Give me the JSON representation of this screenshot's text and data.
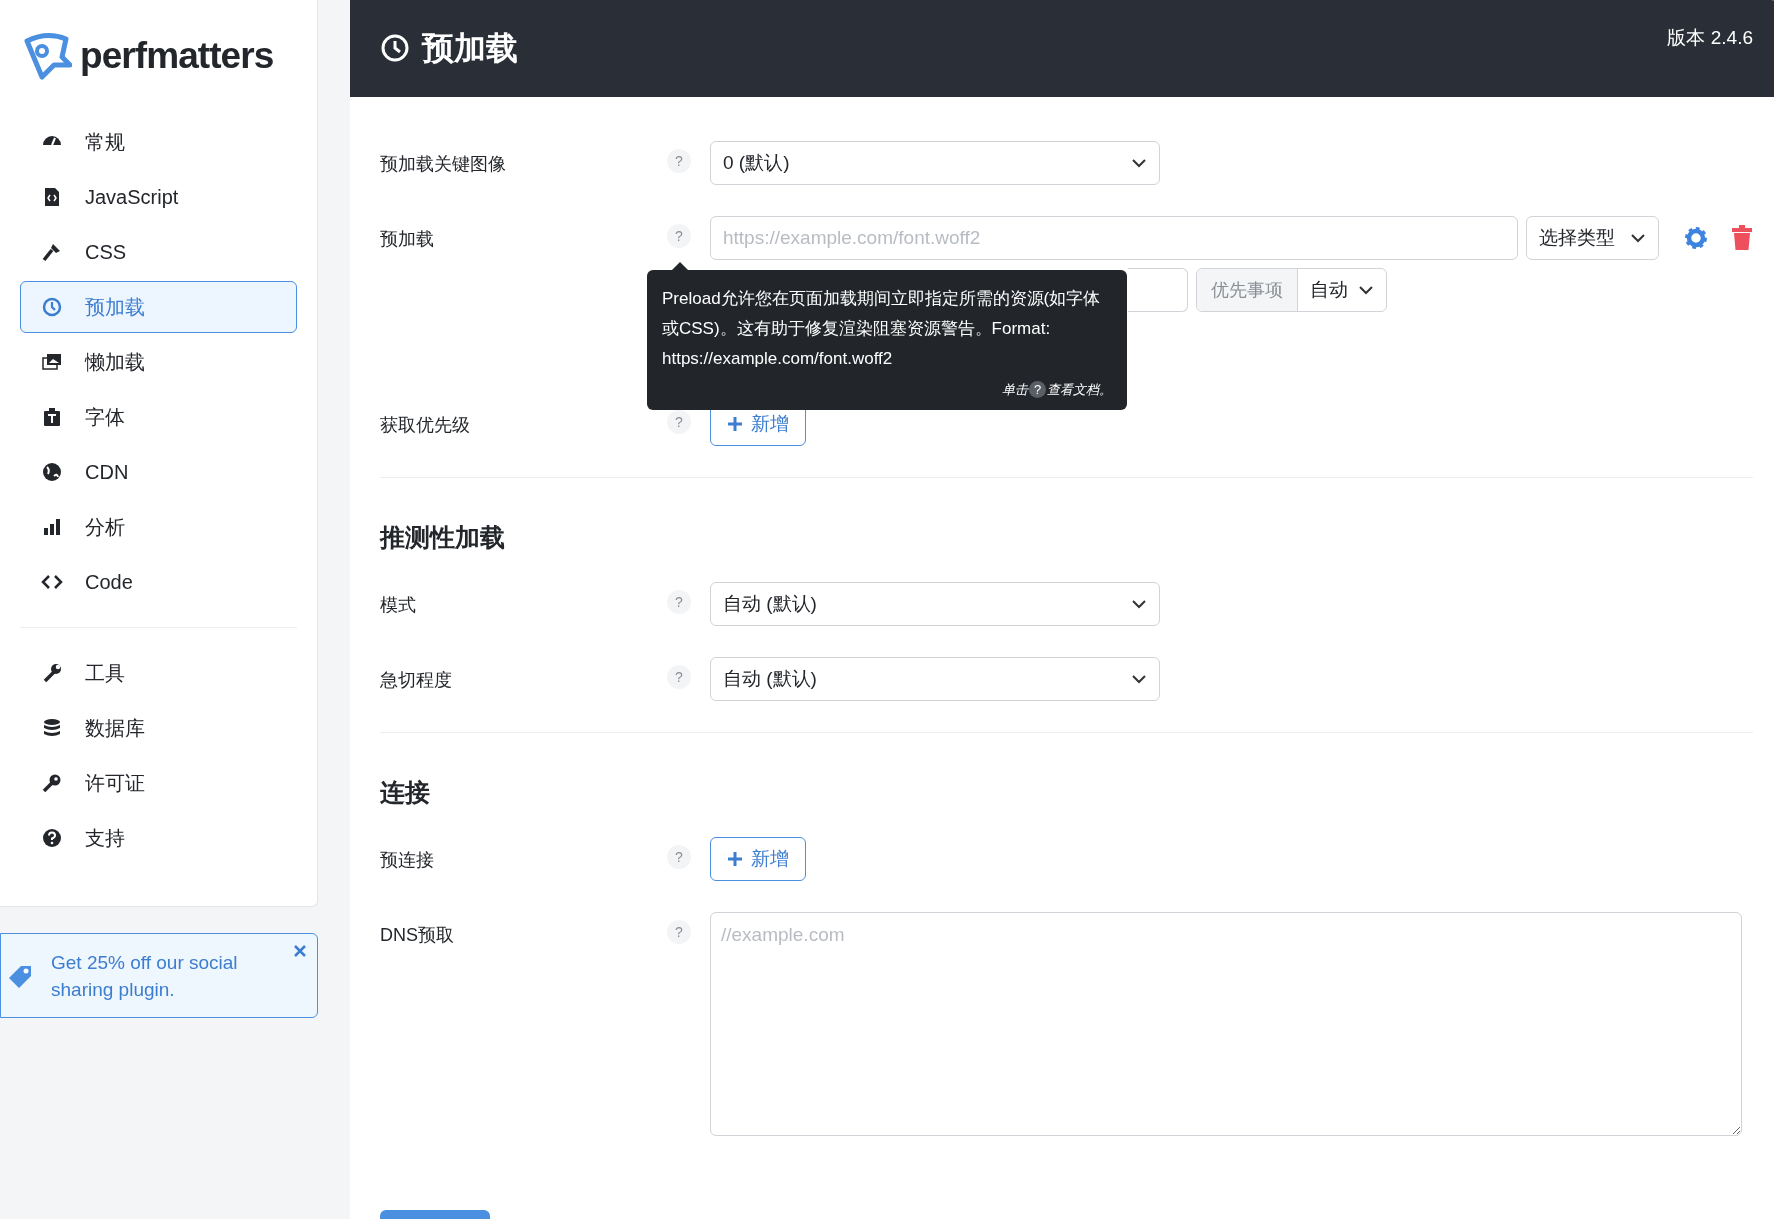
{
  "sidebar": {
    "logo": "perfmatters",
    "groups": [
      [
        {
          "label": "常规",
          "selected": false
        },
        {
          "label": "JavaScript",
          "selected": false
        },
        {
          "label": "CSS",
          "selected": false
        },
        {
          "label": "预加载",
          "selected": true
        },
        {
          "label": "懒加载",
          "selected": false
        },
        {
          "label": "字体",
          "selected": false
        },
        {
          "label": "CDN",
          "selected": false
        },
        {
          "label": "分析",
          "selected": false
        },
        {
          "label": "Code",
          "selected": false
        }
      ],
      [
        {
          "label": "工具",
          "selected": false
        },
        {
          "label": "数据库",
          "selected": false
        },
        {
          "label": "许可证",
          "selected": false
        },
        {
          "label": "支持",
          "selected": false
        }
      ]
    ]
  },
  "promo": {
    "text": "Get 25% off our social sharing plugin."
  },
  "header": {
    "title": "预加载",
    "version": "版本 2.4.6"
  },
  "sections": [
    {
      "rows": [
        {
          "label": "预加载关键图像",
          "help": "?",
          "kind": "select",
          "value": "0 (默认)"
        },
        {
          "label": "预加载",
          "help": "?",
          "kind": "preload",
          "placeholder": "https://example.com/font.woff2",
          "type_value": "选择类型",
          "priority_label": "优先事项",
          "priority_value": "自动"
        },
        {
          "label": "获取优先级",
          "help": "?",
          "kind": "add",
          "button": "新增"
        }
      ]
    },
    {
      "heading": "推测性加载",
      "rows": [
        {
          "label": "模式",
          "help": "?",
          "kind": "select",
          "value": "自动 (默认)"
        },
        {
          "label": "急切程度",
          "help": "?",
          "kind": "select",
          "value": "自动 (默认)"
        }
      ]
    },
    {
      "heading": "连接",
      "rows": [
        {
          "label": "预连接",
          "help": "?",
          "kind": "add",
          "button": "新增"
        },
        {
          "label": "DNS预取",
          "help": "?",
          "kind": "textarea",
          "placeholder": "//example.com"
        }
      ]
    }
  ],
  "tooltip": {
    "text": "Preload允许您在页面加载期间立即指定所需的资源(如字体或CSS)。这有助于修复渲染阻塞资源警告。Format: https://example.com/font.woff2",
    "hint_before": "单击",
    "hint_mark": "?",
    "hint_after": "查看文档。"
  }
}
